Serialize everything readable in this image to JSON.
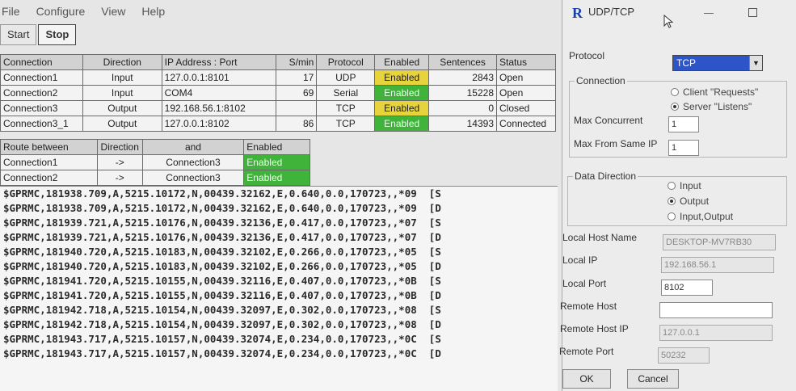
{
  "menu": [
    "File",
    "Configure",
    "View",
    "Help"
  ],
  "toolbar": {
    "start": "Start",
    "stop": "Stop"
  },
  "connections": {
    "headers": [
      "Connection",
      "Direction",
      "IP Address : Port",
      "S/min",
      "Protocol",
      "Enabled",
      "Sentences",
      "Status"
    ],
    "rows": [
      {
        "name": "Connection1",
        "direction": "Input",
        "address": "127.0.0.1:8101",
        "smin": "17",
        "protocol": "UDP",
        "enabled": "Enabled",
        "enabled_color": "yellow",
        "sentences": "2843",
        "status": "Open"
      },
      {
        "name": "Connection2",
        "direction": "Input",
        "address": "COM4",
        "smin": "69",
        "protocol": "Serial",
        "enabled": "Enabled",
        "enabled_color": "green",
        "sentences": "15228",
        "status": "Open"
      },
      {
        "name": "Connection3",
        "direction": "Output",
        "address": "192.168.56.1:8102",
        "smin": "",
        "protocol": "TCP",
        "enabled": "Enabled",
        "enabled_color": "yellow",
        "sentences": "0",
        "status": "Closed"
      },
      {
        "name": "Connection3_1",
        "direction": "Output",
        "address": "127.0.0.1:8102",
        "smin": "86",
        "protocol": "TCP",
        "enabled": "Enabled",
        "enabled_color": "green",
        "sentences": "14393",
        "status": "Connected"
      }
    ]
  },
  "routes": {
    "headers": [
      "Route between",
      "Direction",
      "and",
      "Enabled"
    ],
    "rows": [
      {
        "from": "Connection1",
        "direction": "->",
        "to": "Connection3",
        "enabled": "Enabled"
      },
      {
        "from": "Connection2",
        "direction": "->",
        "to": "Connection3",
        "enabled": "Enabled"
      }
    ]
  },
  "log": [
    "$GPRMC,181938.709,A,5215.10172,N,00439.32162,E,0.640,0.0,170723,,*09  [S",
    "$GPRMC,181938.709,A,5215.10172,N,00439.32162,E,0.640,0.0,170723,,*09  [D",
    "$GPRMC,181939.721,A,5215.10176,N,00439.32136,E,0.417,0.0,170723,,*07  [S",
    "$GPRMC,181939.721,A,5215.10176,N,00439.32136,E,0.417,0.0,170723,,*07  [D",
    "$GPRMC,181940.720,A,5215.10183,N,00439.32102,E,0.266,0.0,170723,,*05  [S",
    "$GPRMC,181940.720,A,5215.10183,N,00439.32102,E,0.266,0.0,170723,,*05  [D",
    "$GPRMC,181941.720,A,5215.10155,N,00439.32116,E,0.407,0.0,170723,,*0B  [S",
    "$GPRMC,181941.720,A,5215.10155,N,00439.32116,E,0.407,0.0,170723,,*0B  [D",
    "$GPRMC,181942.718,A,5215.10154,N,00439.32097,E,0.302,0.0,170723,,*08  [S",
    "$GPRMC,181942.718,A,5215.10154,N,00439.32097,E,0.302,0.0,170723,,*08  [D",
    "$GPRMC,181943.717,A,5215.10157,N,00439.32074,E,0.234,0.0,170723,,*0C  [S",
    "$GPRMC,181943.717,A,5215.10157,N,00439.32074,E,0.234,0.0,170723,,*0C  [D"
  ],
  "dialog": {
    "title": "UDP/TCP",
    "logo_letter": "R",
    "protocol_label": "Protocol",
    "protocol_value": "TCP",
    "connection_group": "Connection",
    "client_option": "Client \"Requests\"",
    "server_option": "Server \"Listens\"",
    "max_concurrent_label": "Max Concurrent",
    "max_concurrent_value": "1",
    "max_from_same_ip_label": "Max From Same IP",
    "max_from_same_ip_value": "1",
    "data_direction_group": "Data Direction",
    "dir_input": "Input",
    "dir_output": "Output",
    "dir_input_output": "Input,Output",
    "local_host_name_label": "Local Host Name",
    "local_host_name_value": "DESKTOP-MV7RB30",
    "local_ip_label": "Local IP",
    "local_ip_value": "192.168.56.1",
    "local_port_label": "Local Port",
    "local_port_value": "8102",
    "remote_host_label": "Remote Host",
    "remote_host_value": "",
    "remote_host_ip_label": "Remote Host IP",
    "remote_host_ip_value": "127.0.0.1",
    "remote_port_label": "Remote Port",
    "remote_port_value": "50232",
    "ok": "OK",
    "cancel": "Cancel"
  },
  "colors": {
    "enabled_yellow": "#e7d43c",
    "enabled_green": "#3fb33a",
    "combo_selected": "#2e55c8"
  }
}
